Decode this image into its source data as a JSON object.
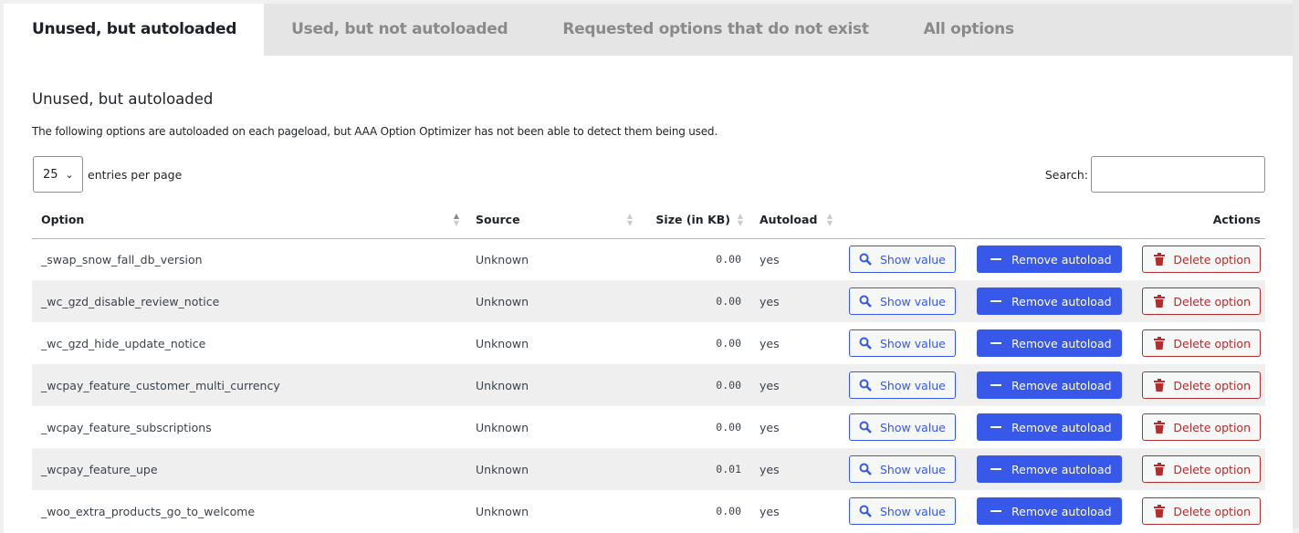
{
  "tabs": [
    {
      "label": "Unused, but autoloaded",
      "active": true
    },
    {
      "label": "Used, but not autoloaded"
    },
    {
      "label": "Requested options that do not exist"
    },
    {
      "label": "All options"
    }
  ],
  "section": {
    "title": "Unused, but autoloaded",
    "description": "The following options are autoloaded on each pageload, but AAA Option Optimizer has not been able to detect them being used."
  },
  "length": {
    "value": "25",
    "label": "entries per page"
  },
  "search": {
    "label": "Search:",
    "value": ""
  },
  "columns": [
    "Option",
    "Source",
    "Size (in KB)",
    "Autoload",
    "Actions"
  ],
  "sort": {
    "column": "Option",
    "direction": "ascending"
  },
  "actions": {
    "show": "Show value",
    "remove": "Remove autoload",
    "delete": "Delete option"
  },
  "colors": {
    "accent": "#3858e9",
    "danger": "#b32d2e"
  },
  "rows": [
    {
      "option": "_swap_snow_fall_db_version",
      "source": "Unknown",
      "size": "0.00",
      "autoload": "yes"
    },
    {
      "option": "_wc_gzd_disable_review_notice",
      "source": "Unknown",
      "size": "0.00",
      "autoload": "yes"
    },
    {
      "option": "_wc_gzd_hide_update_notice",
      "source": "Unknown",
      "size": "0.00",
      "autoload": "yes"
    },
    {
      "option": "_wcpay_feature_customer_multi_currency",
      "source": "Unknown",
      "size": "0.00",
      "autoload": "yes"
    },
    {
      "option": "_wcpay_feature_subscriptions",
      "source": "Unknown",
      "size": "0.00",
      "autoload": "yes"
    },
    {
      "option": "_wcpay_feature_upe",
      "source": "Unknown",
      "size": "0.01",
      "autoload": "yes"
    },
    {
      "option": "_woo_extra_products_go_to_welcome",
      "source": "Unknown",
      "size": "0.00",
      "autoload": "yes"
    }
  ]
}
